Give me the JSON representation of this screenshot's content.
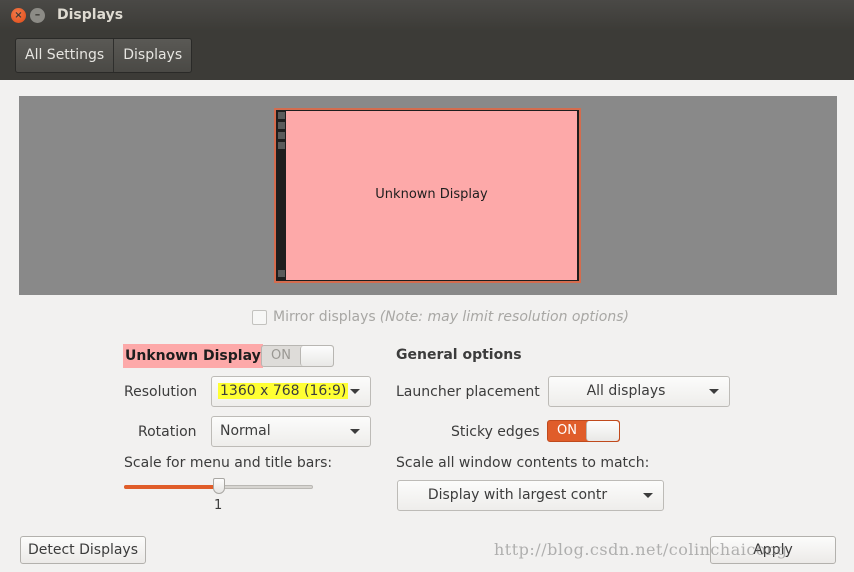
{
  "window": {
    "title": "Displays",
    "close_glyph": "×",
    "minimize_glyph": "–"
  },
  "breadcrumbs": [
    "All Settings",
    "Displays"
  ],
  "arrangement": {
    "monitor_label": "Unknown Display"
  },
  "mirror": {
    "label": "Mirror displays",
    "note": "(Note: may limit resolution options)",
    "checked": false
  },
  "display": {
    "name": "Unknown Display",
    "power_switch": "ON",
    "resolution_label": "Resolution",
    "resolution_value": "1360 x 768 (16:9)",
    "rotation_label": "Rotation",
    "rotation_value": "Normal",
    "scale_label": "Scale for menu and title bars:",
    "scale_value": "1",
    "scale_fraction": 0.5
  },
  "general": {
    "title": "General options",
    "launcher_label": "Launcher placement",
    "launcher_value": "All displays",
    "sticky_label": "Sticky edges",
    "sticky_switch": "ON",
    "scale_all_label": "Scale all window contents to match:",
    "scale_all_value": "Display with largest contr"
  },
  "buttons": {
    "detect": "Detect Displays",
    "apply": "Apply"
  },
  "watermark": "http://blog.csdn.net/colinchaicong",
  "colors": {
    "accent": "#e05d2a",
    "monitor_fill": "#fda9a9",
    "highlight": "#ffff33",
    "titlebar": "#3c3b37"
  },
  "icons": {
    "close": "close-icon",
    "minimize": "minimize-icon",
    "dropdown": "chevron-down-icon"
  }
}
